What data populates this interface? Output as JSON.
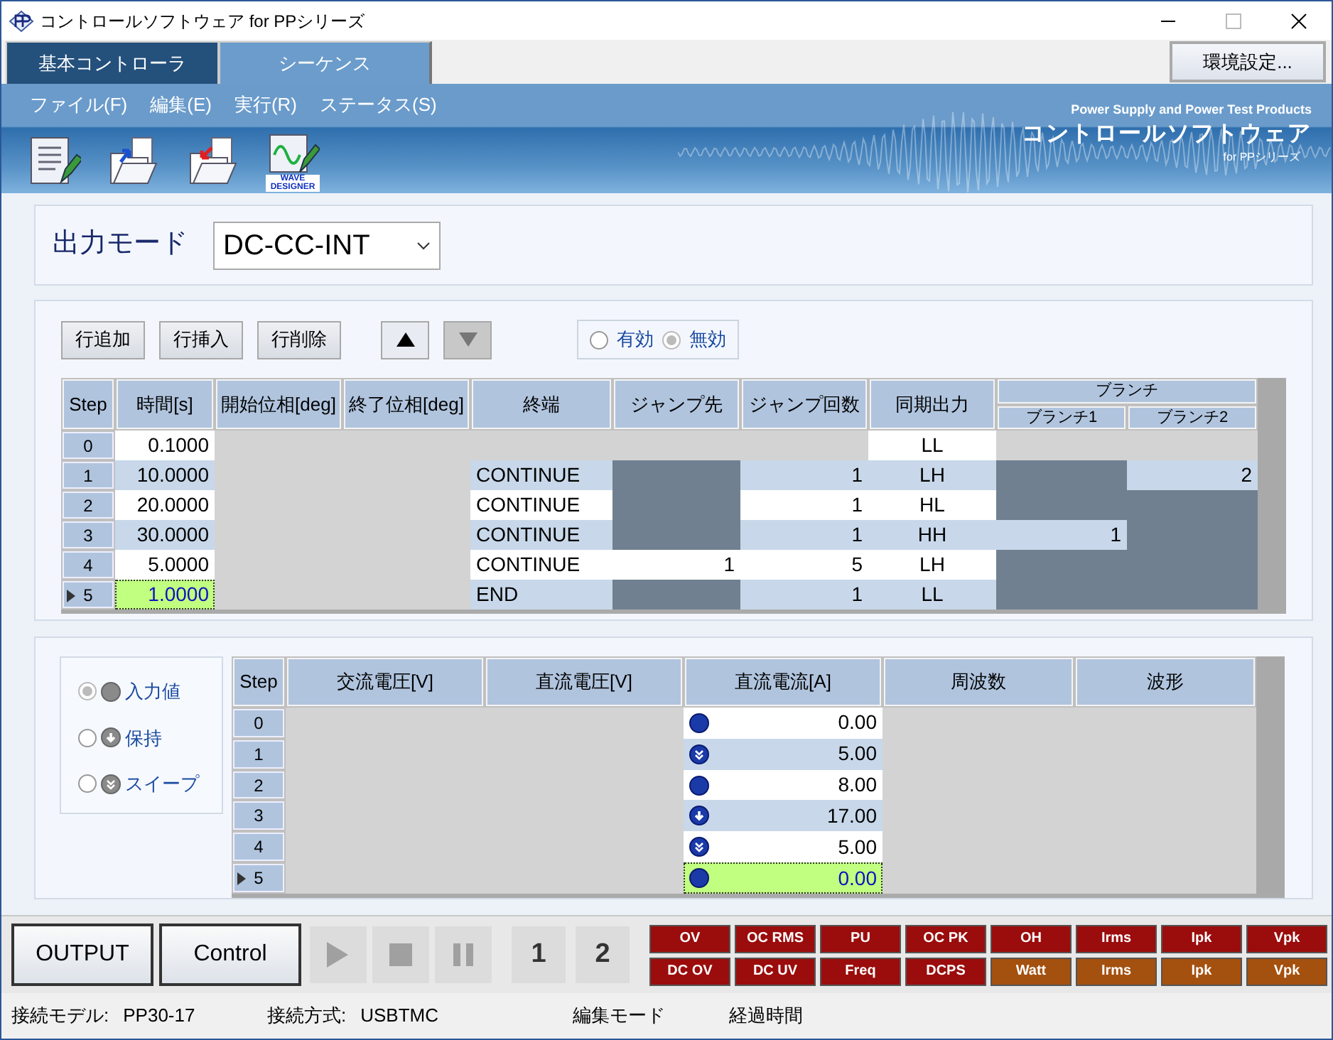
{
  "window": {
    "title": "コントロールソフトウェア for PPシリーズ"
  },
  "tabs": [
    {
      "label": "基本コントローラ",
      "selected": false
    },
    {
      "label": "シーケンス",
      "selected": true
    }
  ],
  "settings_button": "環境設定...",
  "menu": [
    "ファイル(F)",
    "編集(E)",
    "実行(R)",
    "ステータス(S)"
  ],
  "toolbar": [
    {
      "kind": "new"
    },
    {
      "kind": "import"
    },
    {
      "kind": "export"
    },
    {
      "kind": "wave",
      "label": "WAVE DESIGNER"
    }
  ],
  "brand": {
    "tagline": "Power Supply and Power Test Products",
    "name": "コントロールソフトウェア",
    "series": "for PPシリーズ"
  },
  "output_mode": {
    "label": "出力モード",
    "value": "DC-CC-INT"
  },
  "sequence_toolbar": {
    "buttons": [
      "行追加",
      "行挿入",
      "行削除"
    ],
    "move_buttons": [
      {
        "kind": "up",
        "disabled": false
      },
      {
        "kind": "down",
        "disabled": true
      }
    ],
    "radios": [
      {
        "label": "有効",
        "selected": false
      },
      {
        "label": "無効",
        "selected": true
      }
    ]
  },
  "sequence_table": {
    "columns": [
      {
        "label": "Step"
      },
      {
        "label": "時間[s]",
        "kind": "number"
      },
      {
        "label": "開始位相[deg]"
      },
      {
        "label": "終了位相[deg]"
      },
      {
        "label": "終端",
        "kind": "text"
      },
      {
        "label": "ジャンプ先",
        "kind": "number"
      },
      {
        "label": "ジャンプ回数",
        "kind": "number"
      },
      {
        "label": "同期出力",
        "kind": "code"
      },
      {
        "label": "ブランチ",
        "colspan": 2,
        "children": [
          {
            "label": "ブランチ1",
            "kind": "number"
          },
          {
            "label": "ブランチ2",
            "kind": "number"
          }
        ]
      }
    ],
    "rows": [
      {
        "selected": false,
        "cells": [
          {
            "kind": "step",
            "text": "0"
          },
          {
            "kind": "value",
            "text": "0.1000"
          },
          {
            "kind": "na"
          },
          {
            "kind": "na"
          },
          {
            "kind": "na"
          },
          {
            "kind": "na"
          },
          {
            "kind": "na"
          },
          {
            "kind": "value",
            "text": "LL"
          },
          {
            "kind": "na"
          },
          {
            "kind": "na"
          }
        ]
      },
      {
        "selected": false,
        "cells": [
          {
            "kind": "step",
            "text": "1"
          },
          {
            "kind": "value",
            "text": "10.0000"
          },
          {
            "kind": "na"
          },
          {
            "kind": "na"
          },
          {
            "kind": "value",
            "text": "CONTINUE"
          },
          {
            "kind": "off"
          },
          {
            "kind": "value",
            "text": "1"
          },
          {
            "kind": "value",
            "text": "LH"
          },
          {
            "kind": "off"
          },
          {
            "kind": "value",
            "text": "2"
          }
        ]
      },
      {
        "selected": false,
        "cells": [
          {
            "kind": "step",
            "text": "2"
          },
          {
            "kind": "value",
            "text": "20.0000"
          },
          {
            "kind": "na"
          },
          {
            "kind": "na"
          },
          {
            "kind": "value",
            "text": "CONTINUE"
          },
          {
            "kind": "off"
          },
          {
            "kind": "value",
            "text": "1"
          },
          {
            "kind": "value",
            "text": "HL"
          },
          {
            "kind": "off"
          },
          {
            "kind": "off"
          }
        ]
      },
      {
        "selected": false,
        "cells": [
          {
            "kind": "step",
            "text": "3"
          },
          {
            "kind": "value",
            "text": "30.0000"
          },
          {
            "kind": "na"
          },
          {
            "kind": "na"
          },
          {
            "kind": "value",
            "text": "CONTINUE"
          },
          {
            "kind": "off"
          },
          {
            "kind": "value",
            "text": "1"
          },
          {
            "kind": "value",
            "text": "HH"
          },
          {
            "kind": "value",
            "text": "1"
          },
          {
            "kind": "off"
          }
        ]
      },
      {
        "selected": false,
        "cells": [
          {
            "kind": "step",
            "text": "4"
          },
          {
            "kind": "value",
            "text": "5.0000"
          },
          {
            "kind": "na"
          },
          {
            "kind": "na"
          },
          {
            "kind": "value",
            "text": "CONTINUE"
          },
          {
            "kind": "value",
            "text": "1"
          },
          {
            "kind": "value",
            "text": "5"
          },
          {
            "kind": "value",
            "text": "LH"
          },
          {
            "kind": "off"
          },
          {
            "kind": "off"
          }
        ]
      },
      {
        "selected": true,
        "cells": [
          {
            "kind": "step",
            "text": "5"
          },
          {
            "kind": "current",
            "text": "1.0000"
          },
          {
            "kind": "na"
          },
          {
            "kind": "na"
          },
          {
            "kind": "value",
            "text": "END"
          },
          {
            "kind": "off"
          },
          {
            "kind": "value",
            "text": "1"
          },
          {
            "kind": "value",
            "text": "LL"
          },
          {
            "kind": "off"
          },
          {
            "kind": "off"
          }
        ]
      }
    ]
  },
  "value_modes": [
    {
      "label": "入力値",
      "kind": "input",
      "selected": true
    },
    {
      "label": "保持",
      "kind": "hold",
      "selected": false
    },
    {
      "label": "スイープ",
      "kind": "sweep",
      "selected": false
    }
  ],
  "value_table": {
    "columns": [
      {
        "label": "Step"
      },
      {
        "label": "交流電圧[V]"
      },
      {
        "label": "直流電圧[V]"
      },
      {
        "label": "直流電流[A]"
      },
      {
        "label": "周波数"
      },
      {
        "label": "波形"
      }
    ],
    "rows": [
      {
        "selected": false,
        "cells": [
          {
            "kind": "step",
            "text": "0"
          },
          {
            "kind": "na"
          },
          {
            "kind": "na"
          },
          {
            "kind": "value",
            "icon": {
              "kind": "input"
            },
            "text": "0.00"
          },
          {
            "kind": "na"
          },
          {
            "kind": "na"
          }
        ]
      },
      {
        "selected": false,
        "cells": [
          {
            "kind": "step",
            "text": "1"
          },
          {
            "kind": "na"
          },
          {
            "kind": "na"
          },
          {
            "kind": "value",
            "icon": {
              "kind": "sweep"
            },
            "text": "5.00"
          },
          {
            "kind": "na"
          },
          {
            "kind": "na"
          }
        ]
      },
      {
        "selected": false,
        "cells": [
          {
            "kind": "step",
            "text": "2"
          },
          {
            "kind": "na"
          },
          {
            "kind": "na"
          },
          {
            "kind": "value",
            "icon": {
              "kind": "input"
            },
            "text": "8.00"
          },
          {
            "kind": "na"
          },
          {
            "kind": "na"
          }
        ]
      },
      {
        "selected": false,
        "cells": [
          {
            "kind": "step",
            "text": "3"
          },
          {
            "kind": "na"
          },
          {
            "kind": "na"
          },
          {
            "kind": "value",
            "icon": {
              "kind": "hold"
            },
            "text": "17.00"
          },
          {
            "kind": "na"
          },
          {
            "kind": "na"
          }
        ]
      },
      {
        "selected": false,
        "cells": [
          {
            "kind": "step",
            "text": "4"
          },
          {
            "kind": "na"
          },
          {
            "kind": "na"
          },
          {
            "kind": "value",
            "icon": {
              "kind": "sweep"
            },
            "text": "5.00"
          },
          {
            "kind": "na"
          },
          {
            "kind": "na"
          }
        ]
      },
      {
        "selected": true,
        "cells": [
          {
            "kind": "step",
            "text": "5"
          },
          {
            "kind": "na"
          },
          {
            "kind": "na"
          },
          {
            "kind": "current",
            "icon": {
              "kind": "input"
            },
            "text": "0.00"
          },
          {
            "kind": "na"
          },
          {
            "kind": "na"
          }
        ]
      }
    ]
  },
  "output_buttons": [
    "OUTPUT",
    "Control"
  ],
  "playback": [
    {
      "kind": "play",
      "disabled": true
    },
    {
      "kind": "stop",
      "disabled": true
    },
    {
      "kind": "pause",
      "disabled": true
    }
  ],
  "channel_buttons": [
    "1",
    "2"
  ],
  "alarms": [
    {
      "label": "OV",
      "color": "#9b0c0c"
    },
    {
      "label": "OC RMS",
      "color": "#9b0c0c"
    },
    {
      "label": "PU",
      "color": "#9b0c0c"
    },
    {
      "label": "OC PK",
      "color": "#9b0c0c"
    },
    {
      "label": "OH",
      "color": "#9b0c0c"
    },
    {
      "label": "Irms",
      "color": "#9b0c0c"
    },
    {
      "label": "Ipk",
      "color": "#9b0c0c"
    },
    {
      "label": "Vpk",
      "color": "#9b0c0c"
    },
    {
      "label": "DC OV",
      "color": "#9b0c0c"
    },
    {
      "label": "DC UV",
      "color": "#9b0c0c"
    },
    {
      "label": "Freq",
      "color": "#9b0c0c"
    },
    {
      "label": "DCPS",
      "color": "#9b0c0c"
    },
    {
      "label": "Watt",
      "color": "#a4500e"
    },
    {
      "label": "Irms",
      "color": "#a4500e"
    },
    {
      "label": "Ipk",
      "color": "#a4500e"
    },
    {
      "label": "Vpk",
      "color": "#a4500e"
    }
  ],
  "status_bar": [
    {
      "label": "接続モデル:",
      "value": "PP30-17"
    },
    {
      "label": "接続方式:",
      "value": "USBTMC"
    },
    {
      "label": "編集モード"
    },
    {
      "label": "経過時間"
    }
  ]
}
